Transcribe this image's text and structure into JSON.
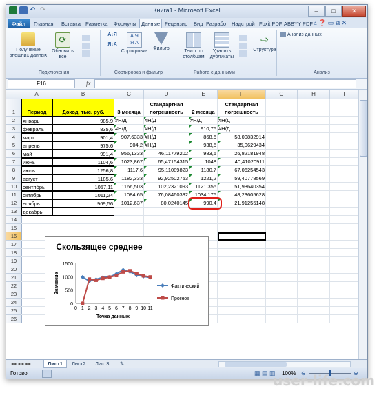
{
  "window": {
    "title": "Книга1 - Microsoft Excel"
  },
  "tabs": [
    "Файл",
    "Главная",
    "Вставка",
    "Разметка",
    "Формулы",
    "Данные",
    "Рецензир",
    "Вид",
    "Разработ",
    "Надстрой",
    "Foxit PDF",
    "ABBYY PDF"
  ],
  "active_tab": "Данные",
  "ribbon": {
    "get_external": "Получение внешних данных",
    "refresh_all": "Обновить все",
    "group_connections": "Подключения",
    "sort": "Сортировка",
    "filter": "Фильтр",
    "group_sort_filter": "Сортировка и фильтр",
    "text_to_columns": "Текст по столбцам",
    "remove_duplicates": "Удалить дубликаты",
    "group_data_tools": "Работа с данными",
    "outline": "Структура",
    "data_analysis": "Анализ данных",
    "group_analysis": "Анализ"
  },
  "formula_bar": {
    "name_box": "F16",
    "fx": "fx",
    "value": ""
  },
  "columns": [
    "A",
    "B",
    "C",
    "D",
    "E",
    "F",
    "G",
    "H",
    "I"
  ],
  "headers": {
    "period": "Период",
    "income": "Доход, тыс. руб.",
    "m3": "3 месяца",
    "std1": "Стандартная погрешность",
    "m2": "2 месяца",
    "std2": "Стандартная погрешность"
  },
  "rows": [
    {
      "a": "январь",
      "b": "985,9",
      "c": "#Н/Д",
      "d": "#Н/Д",
      "e": "#Н/Д",
      "f": "#Н/Д"
    },
    {
      "a": "февраль",
      "b": "835,6",
      "c": "#Н/Д",
      "d": "#Н/Д",
      "e": "910,75",
      "f": "#Н/Д"
    },
    {
      "a": "март",
      "b": "901,4",
      "c": "907,6333",
      "d": "#Н/Д",
      "e": "868,5",
      "f": "58,00832914"
    },
    {
      "a": "апрель",
      "b": "975,6",
      "c": "904,2",
      "d": "#Н/Д",
      "e": "938,5",
      "f": "35,0629434"
    },
    {
      "a": "май",
      "b": "991,4",
      "c": "956,1333",
      "d": "46,11779202",
      "e": "983,5",
      "f": "26,82181948"
    },
    {
      "a": "июнь",
      "b": "1104,6",
      "c": "1023,867",
      "d": "65,47154315",
      "e": "1048",
      "f": "40,41020911"
    },
    {
      "a": "июль",
      "b": "1256,8",
      "c": "1117,6",
      "d": "95,11089823",
      "e": "1180,7",
      "f": "67,06254543"
    },
    {
      "a": "август",
      "b": "1185,6",
      "c": "1182,333",
      "d": "92,92502753",
      "e": "1221,2",
      "f": "59,40778569"
    },
    {
      "a": "сентябрь",
      "b": "1057,11",
      "c": "1166,503",
      "d": "102,2321093",
      "e": "1121,355",
      "f": "51,93640354"
    },
    {
      "a": "октябрь",
      "b": "1011,24",
      "c": "1084,65",
      "d": "76,08460332",
      "e": "1034,175",
      "f": "48,23605628"
    },
    {
      "a": "ноябрь",
      "b": "969,56",
      "c": "1012,637",
      "d": "80,0240145",
      "e": "990,4",
      "f": "21,91255148"
    },
    {
      "a": "декабрь",
      "b": "",
      "c": "",
      "d": "",
      "e": "",
      "f": ""
    }
  ],
  "row_numbers": [
    "1",
    "2",
    "3",
    "4",
    "5",
    "6",
    "7",
    "8",
    "9",
    "10",
    "11",
    "12",
    "13",
    "14",
    "15",
    "16",
    "17",
    "18",
    "19",
    "20",
    "21",
    "22",
    "23",
    "24",
    "25",
    "26"
  ],
  "sheets": [
    "Лист1",
    "Лист2",
    "Лист3"
  ],
  "status": {
    "ready": "Готово",
    "zoom": "100%"
  },
  "watermark": "user-life.com",
  "chart_data": {
    "type": "line",
    "title": "Скользящее среднее",
    "xlabel": "Точка данных",
    "ylabel": "Значение",
    "categories": [
      1,
      2,
      3,
      4,
      5,
      6,
      7,
      8,
      9,
      10,
      11
    ],
    "x_ticks": [
      "0",
      "1",
      "2",
      "3",
      "4",
      "5",
      "6",
      "7",
      "8",
      "9",
      "10",
      "11"
    ],
    "y_ticks": [
      "0",
      "500",
      "1000",
      "1500"
    ],
    "ylim": [
      0,
      1500
    ],
    "xlim": [
      0,
      11
    ],
    "legend_position": "right",
    "series": [
      {
        "name": "Фактический",
        "color": "#4a7ebb",
        "marker": "diamond",
        "values": [
          985.9,
          835.6,
          901.4,
          975.6,
          991.4,
          1104.6,
          1256.8,
          1185.6,
          1057.11,
          1011.24,
          969.56
        ]
      },
      {
        "name": "Прогноз",
        "color": "#be4b48",
        "marker": "square",
        "values": [
          0,
          910.75,
          868.5,
          938.5,
          983.5,
          1048,
          1180.7,
          1221.2,
          1121.355,
          1034.175,
          990.4
        ]
      }
    ]
  }
}
